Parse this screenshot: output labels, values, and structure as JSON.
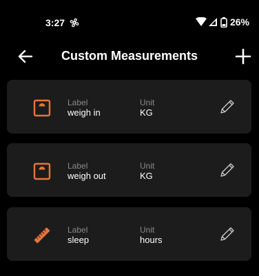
{
  "status": {
    "time": "3:27",
    "battery": "26%"
  },
  "header": {
    "title": "Custom Measurements"
  },
  "measurements": [
    {
      "label_heading": "Label",
      "label": "weigh in",
      "unit_heading": "Unit",
      "unit": "KG",
      "icon": "scale-icon"
    },
    {
      "label_heading": "Label",
      "label": "weigh out",
      "unit_heading": "Unit",
      "unit": "KG",
      "icon": "scale-icon"
    },
    {
      "label_heading": "Label",
      "label": "sleep",
      "unit_heading": "Unit",
      "unit": "hours",
      "icon": "ruler-icon"
    }
  ],
  "colors": {
    "accent": "#e8743b",
    "card": "#1c1c1c",
    "muted": "#8a8a8a"
  }
}
